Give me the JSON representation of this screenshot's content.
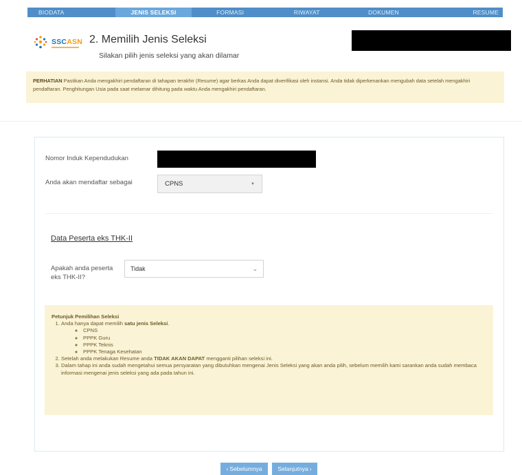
{
  "nav": {
    "tabs": [
      {
        "label": "BIODATA"
      },
      {
        "label": "JENIS SELEKSI"
      },
      {
        "label": "FORMASI"
      },
      {
        "label": "RIWAYAT"
      },
      {
        "label": "DOKUMEN"
      },
      {
        "label": "RESUME"
      }
    ],
    "active_index": 1
  },
  "header": {
    "logo_text_main": "SSC",
    "logo_text_accent": "ASN",
    "title": "2. Memilih Jenis Seleksi",
    "subtitle": "Silakan pilih jenis seleksi yang akan dilamar"
  },
  "warning": {
    "label": "PERHATIAN",
    "text": " Pastikan Anda mengakhiri pendaftaran di tahapan terakhir (Resume) agar berkas Anda dapat diverifikasi oleh instansi. Anda tidak diperkenankan mengubah data setelah mengakhiri pendaftaran. Penghitungan Usia pada saat melamar dihitung pada waktu Anda mengakhiri pendaftaran."
  },
  "form": {
    "nik_label": "Nomor Induk Kependudukan",
    "daftar_label": "Anda akan mendaftar sebagai",
    "daftar_value": "CPNS",
    "section_title": "Data Peserta eks THK-II",
    "thk_label_line1": "Apakah anda peserta",
    "thk_label_line2": "eks THK-II?",
    "thk_value": "Tidak"
  },
  "petunjuk": {
    "title": "Petunjuk Pemilihan Seleksi",
    "item1_pre": "Anda hanya dapat memilih ",
    "item1_bold": "satu jenis Seleksi",
    "item1_post": ".",
    "options": [
      "CPNS",
      "PPPK Guru",
      "PPPK Teknis",
      "PPPK Tenaga Kesehatan"
    ],
    "item2_pre": "Setelah anda melakukan Resume anda ",
    "item2_bold": "TIDAK AKAN DAPAT",
    "item2_post": " mengganti pilihan seleksi ini.",
    "item3": "Dalam tahap ini anda sudah mengetahui semua persyaratan yang dibutuhkan mengenai Jenis Seleksi yang akan anda pilih, sebelum memilih kami sarankan anda sudah membaca informasi mengenai jenis seleksi yang ada pada tahun ini."
  },
  "buttons": {
    "prev_label": "Sebelumnya",
    "next_label": "Selanjutnya"
  },
  "colors": {
    "nav_bg": "#4f8ec9",
    "nav_active": "#6aa7dc",
    "notice_bg": "#fbf3d5",
    "button_bg": "#75aede"
  }
}
